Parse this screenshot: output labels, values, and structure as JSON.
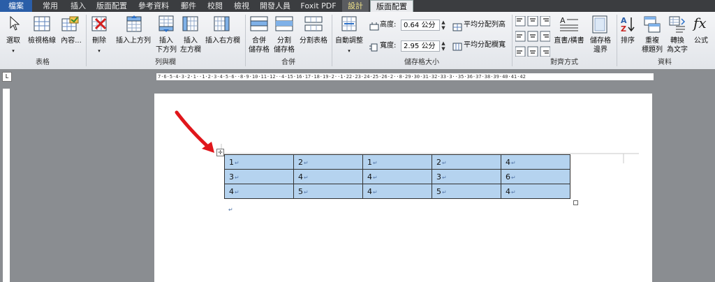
{
  "tabs": [
    {
      "label": "檔案"
    },
    {
      "label": "常用"
    },
    {
      "label": "插入"
    },
    {
      "label": "版面配置"
    },
    {
      "label": "參考資料"
    },
    {
      "label": "郵件"
    },
    {
      "label": "校閱"
    },
    {
      "label": "檢視"
    },
    {
      "label": "開發人員"
    },
    {
      "label": "Foxit PDF"
    },
    {
      "label": "設計"
    },
    {
      "label": "版面配置"
    }
  ],
  "ribbon": {
    "groups": [
      {
        "label": "表格"
      },
      {
        "label": "列與欄"
      },
      {
        "label": "合併"
      },
      {
        "label": "儲存格大小"
      },
      {
        "label": "對齊方式"
      },
      {
        "label": "資料"
      }
    ],
    "select": "選取",
    "gridlines": "檢視格線",
    "properties": "內容...",
    "delete": "刪除",
    "insert_above": "插入上方列",
    "insert_below": "插入",
    "insert_below_2": "下方列",
    "insert_left": "插入",
    "insert_left_2": "左方欄",
    "insert_right": "插入右方欄",
    "merge": "合併",
    "merge_2": "儲存格",
    "split_cells": "分割",
    "split_cells_2": "儲存格",
    "split_table": "分割表格",
    "autofit": "自動調整",
    "height_label": "高度:",
    "height_value": "0.64 公分",
    "width_label": "寬度:",
    "width_value": "2.95 公分",
    "dist_rows": "平均分配列高",
    "dist_cols": "平均分配欄寬",
    "text_direction": "直書/橫書",
    "cell_margins": "儲存格",
    "cell_margins_2": "邊界",
    "sort": "排序",
    "repeat_header": "重複",
    "repeat_header_2": "標題列",
    "convert": "轉換",
    "convert_2": "為文字",
    "formula": "公式",
    "fx_glyph": "fx"
  },
  "ruler": {
    "text": "7·6·5·4·3·2·1··1·2·3·4·5·6··8·9·10·11·12··4·15·16·17·18·19·2··1·22·23·24·25·26·2··8·29·30·31·32·33·3··35·36·37·38·39·40·41·42"
  },
  "table": {
    "rows": [
      [
        "1",
        "2",
        "1",
        "2",
        "4"
      ],
      [
        "3",
        "4",
        "4",
        "3",
        "6"
      ],
      [
        "4",
        "5",
        "4",
        "5",
        "4"
      ]
    ]
  },
  "colors": {
    "selection": "#b5d3ef",
    "file_tab": "#2a5ea8",
    "arrow": "#e0161b"
  }
}
